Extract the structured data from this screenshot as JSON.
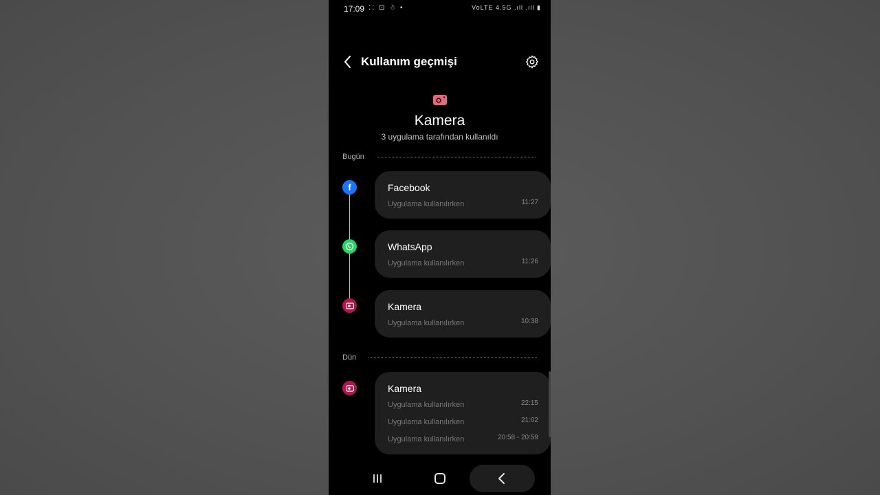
{
  "status_bar": {
    "time": "17:09",
    "left_icons": "⁚⁚ ⊡ ☃ •",
    "right_icons": "VoLTE 4.5G .ıll .ıll ▮"
  },
  "header": {
    "title": "Kullanım geçmişi",
    "back_icon": "back-arrow-icon",
    "settings_icon": "gear-icon"
  },
  "hero": {
    "icon": "camera-icon",
    "icon_color": "#e26a7c",
    "title": "Kamera",
    "subtitle": "3 uygulama tarafından kullanıldı"
  },
  "sections": [
    {
      "label": "Bugün",
      "entries": [
        {
          "app": "Facebook",
          "icon": "facebook-icon",
          "color": "#1877f2",
          "rows": [
            {
              "label": "Uygulama kullanılırken",
              "time": "11:27"
            }
          ]
        },
        {
          "app": "WhatsApp",
          "icon": "whatsapp-icon",
          "color": "#25d366",
          "rows": [
            {
              "label": "Uygulama kullanılırken",
              "time": "11:26"
            }
          ]
        },
        {
          "app": "Kamera",
          "icon": "camera-icon",
          "color": "#b1174f",
          "rows": [
            {
              "label": "Uygulama kullanılırken",
              "time": "10:38"
            }
          ]
        }
      ]
    },
    {
      "label": "Dün",
      "entries": [
        {
          "app": "Kamera",
          "icon": "camera-icon",
          "color": "#b1174f",
          "rows": [
            {
              "label": "Uygulama kullanılırken",
              "time": "22:15"
            },
            {
              "label": "Uygulama kullanılırken",
              "time": "21:02"
            },
            {
              "label": "Uygulama kullanılırken",
              "time": "20:58 - 20:59"
            }
          ]
        }
      ]
    }
  ],
  "nav_bar": {
    "recent_icon": "recent-apps-icon",
    "home_icon": "home-icon",
    "back_icon": "nav-back-icon"
  }
}
